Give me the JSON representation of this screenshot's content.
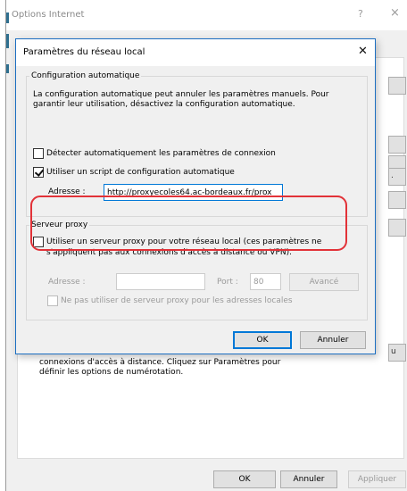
{
  "background_window": {
    "title": "Options Internet",
    "help_glyph": "?",
    "close_glyph": "×",
    "side_stubs": [
      "",
      "",
      "",
      ".",
      "",
      "",
      "u"
    ],
    "dialup_text": "connexions d'accès à distance. Cliquez sur Paramètres pour définir les options de numérotation.",
    "buttons": {
      "ok": "OK",
      "cancel": "Annuler",
      "apply": "Appliquer"
    }
  },
  "dialog": {
    "title": "Paramètres du réseau local",
    "close_glyph": "✕",
    "auto_config": {
      "legend": "Configuration automatique",
      "description": "La configuration automatique peut annuler les paramètres manuels. Pour garantir leur utilisation, désactivez la configuration automatique.",
      "detect_label": "Détecter automatiquement les paramètres de connexion",
      "detect_checked": false,
      "script_label": "Utiliser un script de configuration automatique",
      "script_checked": true,
      "address_label": "Adresse :",
      "address_value": "http://proxyecoles64.ac-bordeaux.fr/prox"
    },
    "proxy": {
      "legend": "Serveur proxy",
      "use_proxy_label": "Utiliser un serveur proxy pour votre réseau local (ces paramètres ne s'appliquent pas aux connexions d'accès à distance ou VPN).",
      "use_proxy_checked": false,
      "address_label": "Adresse :",
      "address_value": "",
      "port_label": "Port :",
      "port_value": "80",
      "advanced_label": "Avancé",
      "bypass_label": "Ne pas utiliser de serveur proxy pour les adresses locales",
      "bypass_checked": false
    },
    "buttons": {
      "ok": "OK",
      "cancel": "Annuler"
    }
  },
  "colors": {
    "highlight_ring": "#e23238",
    "dialog_border": "#1c6fc2",
    "focus_blue": "#0078d7"
  }
}
